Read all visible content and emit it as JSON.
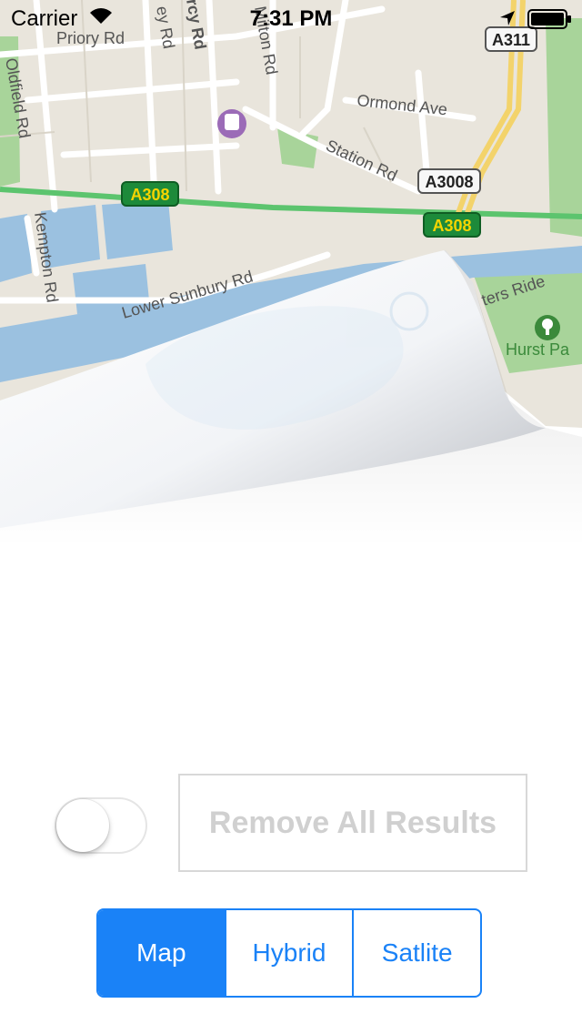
{
  "status_bar": {
    "carrier": "Carrier",
    "time": "7:31 PM"
  },
  "map": {
    "labels": {
      "priory_rd": "Priory Rd",
      "oldfield_rd": "Oldfield Rd",
      "milton_rd": "Milton Rd",
      "ormond_ave": "Ormond Ave",
      "station_rd": "Station Rd",
      "kempton_rd": "Kempton Rd",
      "lower_sunbury_rd": "Lower Sunbury Rd",
      "hurst_park": "Hurst Pa",
      "riverside": "ters Ride",
      "rd_top1": "ey Rd",
      "rd_top2": "rcy Rd"
    },
    "shields": {
      "a311": "A311",
      "a3008": "A3008",
      "a308_left": "A308",
      "a308_right": "A308"
    },
    "colors": {
      "land": "#e9e5dc",
      "road": "#ffffff",
      "water": "#9bc1e0",
      "park": "#a8d49a",
      "green_route": "#5cc46e",
      "yellow_route": "#f3d36b"
    }
  },
  "controls": {
    "toggle_on": false,
    "remove_button": "Remove All Results",
    "segments": [
      "Map",
      "Hybrid",
      "Satlite"
    ],
    "selected_segment": "Map",
    "accent": "#1a82f7"
  }
}
